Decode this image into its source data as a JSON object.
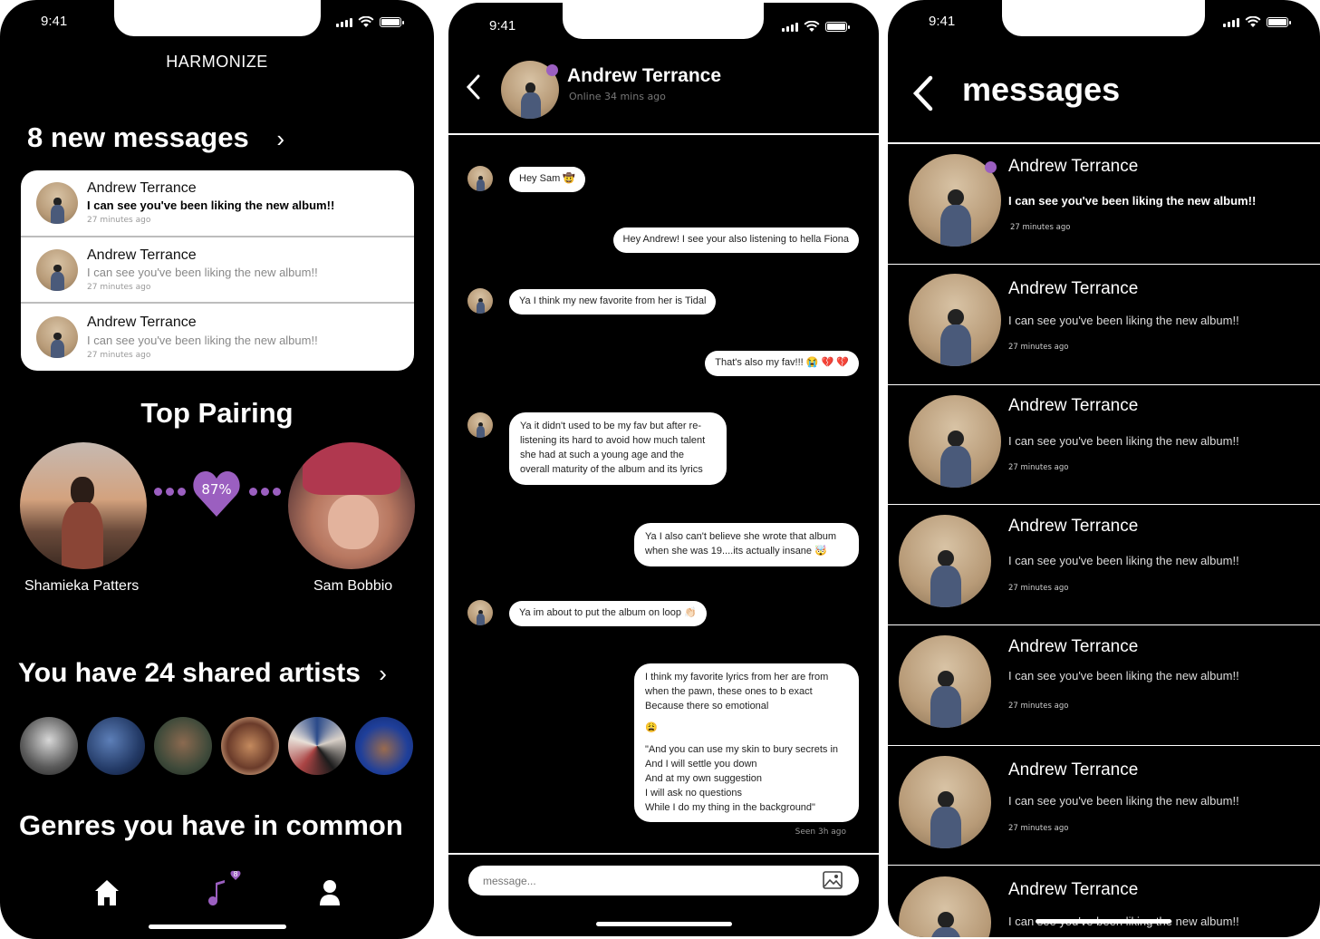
{
  "status": {
    "time": "9:41"
  },
  "home": {
    "logo": "HARMONIZE",
    "new_messages_heading": "8 new messages",
    "messages": [
      {
        "name": "Andrew Terrance",
        "body": "I can see you've been liking the new album!!",
        "time": "27 minutes ago",
        "unread": true
      },
      {
        "name": "Andrew Terrance",
        "body": "I can see you've been liking the new album!!",
        "time": "27 minutes ago",
        "unread": false
      },
      {
        "name": "Andrew Terrance",
        "body": "I can see you've been liking the new album!!",
        "time": "27 minutes ago",
        "unread": false
      }
    ],
    "top_pairing_heading": "Top Pairing",
    "pairing": {
      "left_name": "Shamieka Patters",
      "right_name": "Sam Bobbio",
      "match_percent": "87%"
    },
    "shared_artists_heading": "You have 24 shared artists",
    "genres_heading": "Genres you have in common",
    "nav": {
      "home_icon": "home-icon",
      "music_icon": "music-note-icon",
      "music_badge": "8",
      "profile_icon": "profile-icon"
    },
    "accent_color": "#9b5fc0"
  },
  "chat": {
    "contact_name": "Andrew Terrance",
    "contact_status": "Online 34 mins ago",
    "messages": [
      {
        "from": "them",
        "text": "Hey Sam 🤠"
      },
      {
        "from": "me",
        "text": "Hey Andrew! I see your also listening to hella Fiona"
      },
      {
        "from": "them",
        "text": "Ya I think my new favorite from her is Tidal"
      },
      {
        "from": "me",
        "text": "That's also my fav!!! 😭 💔 💔"
      },
      {
        "from": "them",
        "text": "Ya it didn't used to be my fav but after re-listening its hard to avoid how much talent she had at such a young age and the overall maturity of the album and its lyrics"
      },
      {
        "from": "me",
        "text": "Ya I also can't believe she wrote that album when she was 19....its actually insane 🤯"
      },
      {
        "from": "them",
        "text": "Ya im about to put the album on loop 👏🏻"
      },
      {
        "from": "me",
        "lines": [
          "I think my favorite lyrics from her are from",
          "when the pawn, these ones to b exact",
          "Because there so emotional",
          "",
          "😩",
          "",
          "\"And you can use my skin to bury secrets in",
          "And I will settle you down",
          "And at my own suggestion",
          "I will ask no questions",
          "While I do my thing in the background\""
        ]
      }
    ],
    "seen": "Seen 3h ago",
    "input_placeholder": "message..."
  },
  "inbox": {
    "title": "messages",
    "items": [
      {
        "name": "Andrew Terrance",
        "body": "I can see you've been liking the new album!!",
        "time": "27 minutes ago",
        "unread": true
      },
      {
        "name": "Andrew Terrance",
        "body": "I can see you've been liking the new album!!",
        "time": "27 minutes ago",
        "unread": false
      },
      {
        "name": "Andrew Terrance",
        "body": "I can see you've been liking the new album!!",
        "time": "27 minutes ago",
        "unread": false
      },
      {
        "name": "Andrew Terrance",
        "body": "I can see you've been liking the new album!!",
        "time": "27 minutes ago",
        "unread": false
      },
      {
        "name": "Andrew Terrance",
        "body": "I can see you've been liking the new album!!",
        "time": "27 minutes ago",
        "unread": false
      },
      {
        "name": "Andrew Terrance",
        "body": "I can see you've been liking the new album!!",
        "time": "27 minutes ago",
        "unread": false
      },
      {
        "name": "Andrew Terrance",
        "body": "I can see you've been liking the new album!!",
        "time": "",
        "unread": false
      }
    ]
  }
}
